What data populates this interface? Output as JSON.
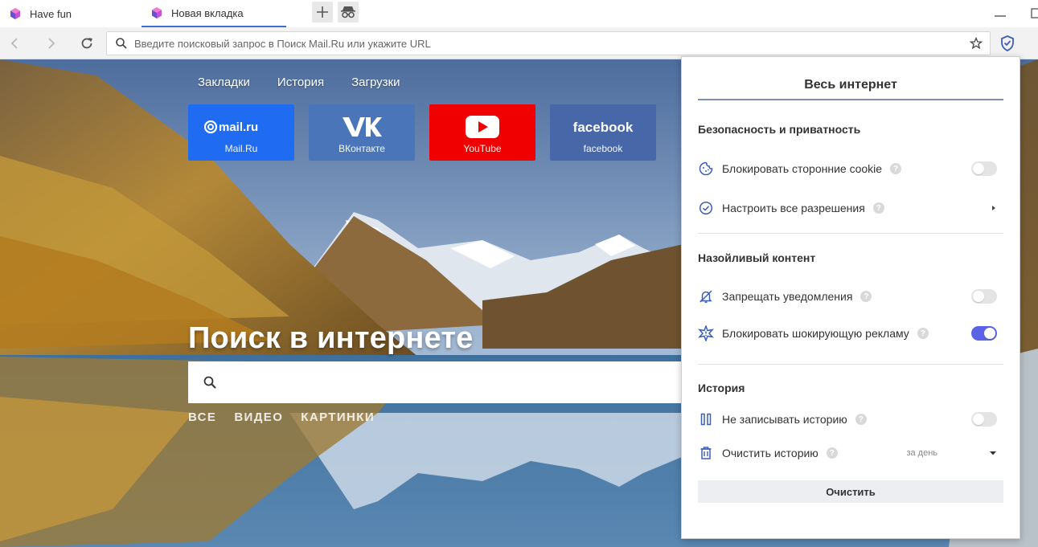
{
  "tabs": [
    {
      "title": "Have fun",
      "active": false
    },
    {
      "title": "Новая вкладка",
      "active": true
    }
  ],
  "omnibox": {
    "placeholder": "Введите поисковый запрос в Поиск Mail.Ru или укажите URL",
    "value": ""
  },
  "page": {
    "nav": [
      "Закладки",
      "История",
      "Загрузки"
    ],
    "tiles": [
      {
        "logo": "mail.ru",
        "label": "Mail.Ru",
        "color": "#1f6bf2"
      },
      {
        "logo": "vk",
        "label": "ВКонтакте",
        "color": "#4a76b9"
      },
      {
        "logo": "youtube",
        "label": "YouTube",
        "color": "#f00000"
      },
      {
        "logo": "facebook",
        "label": "facebook",
        "color": "#4767a9"
      }
    ],
    "hero_title": "Поиск в интернете",
    "search_value": "",
    "search_modes": [
      "ВСЕ",
      "ВИДЕО",
      "КАРТИНКИ"
    ]
  },
  "panel": {
    "title": "Весь интернет",
    "sections": [
      {
        "heading": "Безопасность и приватность",
        "rows": [
          {
            "label": "Блокировать сторонние cookie",
            "icon": "cookie-icon",
            "control": "toggle",
            "on": false
          },
          {
            "label": "Настроить все разрешения",
            "icon": "check-circle-icon",
            "control": "chevron"
          }
        ]
      },
      {
        "heading": "Назойливый контент",
        "rows": [
          {
            "label": "Запрещать уведомления",
            "icon": "bell-off-icon",
            "control": "toggle",
            "on": false
          },
          {
            "label": "Блокировать шокирующую рекламу",
            "icon": "star-burst-icon",
            "control": "toggle",
            "on": true
          }
        ]
      },
      {
        "heading": "История",
        "rows": [
          {
            "label": "Не записывать историю",
            "icon": "pause-icon",
            "control": "toggle",
            "on": false
          },
          {
            "label": "Очистить историю",
            "icon": "trash-icon",
            "control": "select",
            "value": "за день"
          }
        ]
      }
    ],
    "clear_button": "Очистить",
    "help_glyph": "?"
  },
  "colors": {
    "accent": "#5a63e6",
    "tab_underline": "#3b6fd8",
    "icon_blue": "#3b5fb8"
  }
}
